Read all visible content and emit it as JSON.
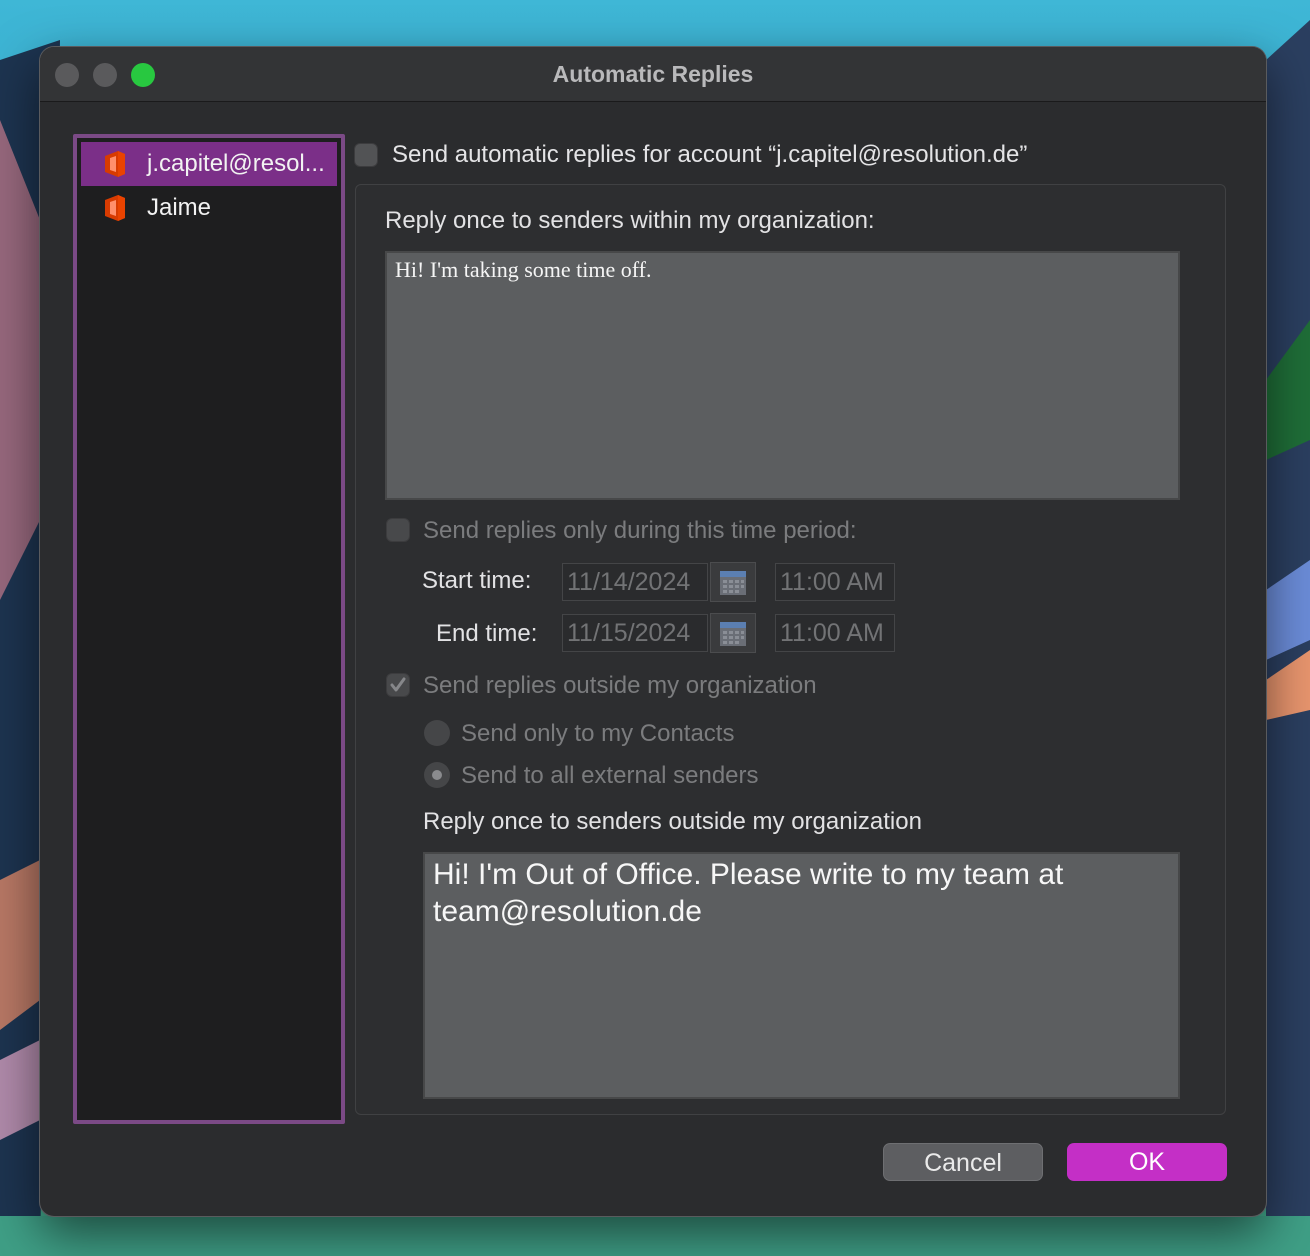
{
  "window": {
    "title": "Automatic Replies"
  },
  "accounts": [
    {
      "label": "j.capitel@resol...",
      "selected": true,
      "icon": "office-icon"
    },
    {
      "label": "Jaime",
      "selected": false,
      "icon": "office-icon"
    }
  ],
  "main": {
    "enable_label": "Send automatic replies for account “j.capitel@resolution.de”",
    "enable_checked": false,
    "internal_label": "Reply once to senders within my organization:",
    "internal_message": "Hi! I'm taking some time off.",
    "time_period_label": "Send replies only during this time period:",
    "time_period_checked": false,
    "start_label": "Start time:",
    "start_date": "11/14/2024",
    "start_time": "11:00 AM",
    "end_label": "End time:",
    "end_date": "11/15/2024",
    "end_time": "11:00 AM",
    "outside_label": "Send replies outside my organization",
    "outside_checked": true,
    "contacts_only_label": "Send only to my Contacts",
    "all_external_label": "Send to all external senders",
    "all_external_selected": true,
    "external_label": "Reply once to senders outside my organization",
    "external_message": "Hi! I'm Out of Office. Please write to my team at team@resolution.de"
  },
  "buttons": {
    "cancel": "Cancel",
    "ok": "OK"
  },
  "colors": {
    "accent": "#c42fc6",
    "selection": "#7b2f88",
    "close": "#5a5a5c",
    "minimize": "#5a5a5c",
    "zoom": "#28c840"
  }
}
